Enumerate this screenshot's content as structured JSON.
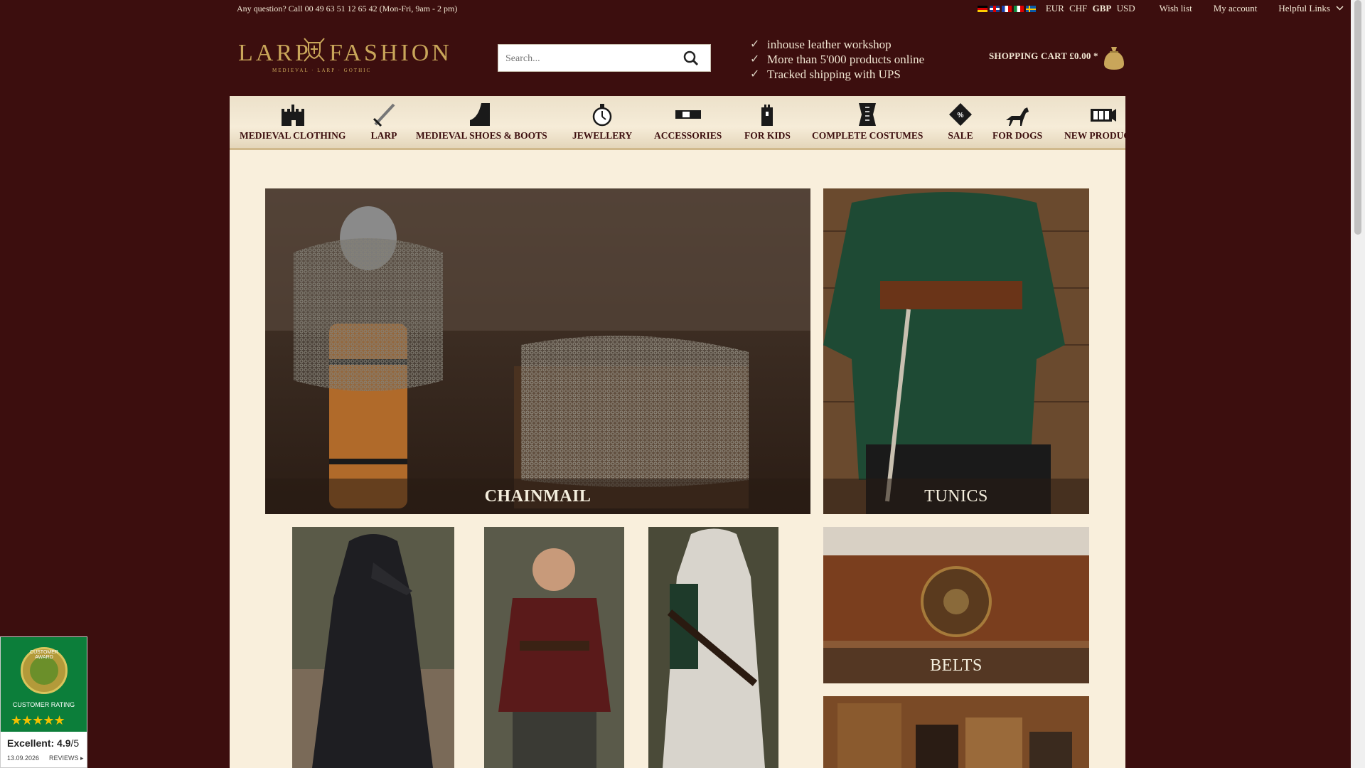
{
  "topbar": {
    "question": "Any question? Call 00 49 63 51 12 65 42 (Mon-Fri, 9am - 2 pm)",
    "flags": [
      "de",
      "en",
      "fr",
      "it",
      "se"
    ],
    "currencies": [
      "EUR",
      "CHF",
      "GBP",
      "USD"
    ],
    "active_currency": "GBP",
    "wish_list": "Wish list",
    "my_account": "My account",
    "helpful_links": "Helpful Links"
  },
  "header": {
    "logo_word1": "LARP",
    "logo_word2": "FASHION",
    "logo_tagline": "MEDIEVAL · LARP · GOTHIC",
    "search_placeholder": "Search...",
    "usp": [
      "inhouse leather workshop",
      "More than 5'000 products online",
      "Tracked shipping with UPS"
    ],
    "cart_label": "SHOPPING CART £0.00 *"
  },
  "nav": [
    {
      "label": "MEDIEVAL CLOTHING",
      "icon": "castle-icon"
    },
    {
      "label": "LARP",
      "icon": "sword-icon"
    },
    {
      "label": "MEDIEVAL SHOES & BOOTS",
      "icon": "boot-icon"
    },
    {
      "label": "JEWELLERY",
      "icon": "pocket-watch-icon"
    },
    {
      "label": "ACCESSORIES",
      "icon": "belt-buckle-icon"
    },
    {
      "label": "FOR KIDS",
      "icon": "tower-icon"
    },
    {
      "label": "COMPLETE COSTUMES",
      "icon": "corset-icon"
    },
    {
      "label": "SALE",
      "icon": "price-tag-icon"
    },
    {
      "label": "FOR DOGS",
      "icon": "dog-icon"
    },
    {
      "label": "NEW PRODUCTS",
      "icon": "film-icon"
    }
  ],
  "tiles": {
    "chainmail": "CHAINMAIL",
    "tunics": "TUNICS",
    "belts": "BELTS"
  },
  "badge": {
    "award_text": "CUSTOMER AWARD",
    "label": "CUSTOMER RATING",
    "stars": "★★★★★",
    "rating_prefix": "Excellent: 4.9",
    "rating_suffix": "/5",
    "date": "13.09.2026",
    "reviews": "REVIEWS ▸"
  },
  "colors": {
    "background": "#3c0e0e",
    "panel": "#f9efdc",
    "gold": "#c9a65a",
    "badge_green": "#0c7e3a"
  }
}
